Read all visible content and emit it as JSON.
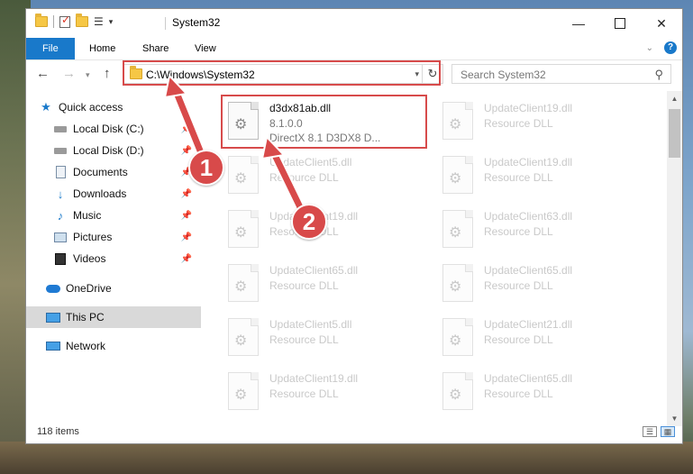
{
  "window": {
    "title": "System32",
    "controls": {
      "minimize": "—",
      "maximize": "",
      "close": "✕"
    }
  },
  "ribbon": {
    "tabs": [
      {
        "label": "File",
        "active": true
      },
      {
        "label": "Home"
      },
      {
        "label": "Share"
      },
      {
        "label": "View"
      }
    ],
    "help_glyph": "?"
  },
  "navbar": {
    "address": "C:\\Windows\\System32",
    "search_placeholder": "Search System32"
  },
  "nav_pane": {
    "items": [
      {
        "label": "Quick access",
        "icon": "star-icon",
        "pinned": false
      },
      {
        "label": "Local Disk (C:)",
        "icon": "drive-icon",
        "pinned": true
      },
      {
        "label": "Local Disk (D:)",
        "icon": "drive-icon",
        "pinned": true
      },
      {
        "label": "Documents",
        "icon": "documents-icon",
        "pinned": true
      },
      {
        "label": "Downloads",
        "icon": "downloads-icon",
        "pinned": true
      },
      {
        "label": "Music",
        "icon": "music-icon",
        "pinned": true
      },
      {
        "label": "Pictures",
        "icon": "pictures-icon",
        "pinned": true
      },
      {
        "label": "Videos",
        "icon": "videos-icon",
        "pinned": true
      },
      {
        "label": "OneDrive",
        "icon": "onedrive-icon",
        "pinned": false
      },
      {
        "label": "This PC",
        "icon": "this-pc-icon",
        "pinned": false,
        "selected": true
      },
      {
        "label": "Network",
        "icon": "network-icon",
        "pinned": false
      }
    ]
  },
  "files": [
    {
      "name": "d3dx81ab.dll",
      "line1": "8.1.0.0",
      "line2": "DirectX 8.1 D3DX8 D...",
      "highlighted": true
    },
    {
      "name": "UpdateClient19.dll",
      "line1": "Resource DLL"
    },
    {
      "name": "UpdateClient5.dll",
      "line1": "Resource DLL"
    },
    {
      "name": "UpdateClient19.dll",
      "line1": "Resource DLL"
    },
    {
      "name": "UpdateClient19.dll",
      "line1": "Resource DLL"
    },
    {
      "name": "UpdateClient63.dll",
      "line1": "Resource DLL"
    },
    {
      "name": "UpdateClient65.dll",
      "line1": "Resource DLL"
    },
    {
      "name": "UpdateClient65.dll",
      "line1": "Resource DLL"
    },
    {
      "name": "UpdateClient5.dll",
      "line1": "Resource DLL"
    },
    {
      "name": "UpdateClient21.dll",
      "line1": "Resource DLL"
    },
    {
      "name": "UpdateClient19.dll",
      "line1": "Resource DLL"
    },
    {
      "name": "UpdateClient65.dll",
      "line1": "Resource DLL"
    }
  ],
  "status": {
    "item_count": "118 items"
  },
  "annotations": {
    "step1": "1",
    "step2": "2",
    "color": "#d84a4a"
  }
}
